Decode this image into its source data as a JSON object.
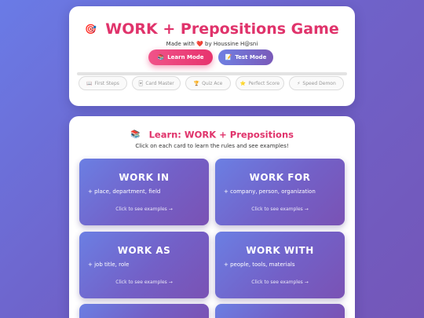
{
  "header": {
    "title_icon": "🎯",
    "title": "WORK + Prepositions Game",
    "credit_prefix": "Made with",
    "credit_heart": "❤️",
    "credit_suffix": "by Houssine H@sni",
    "learn_mode": {
      "icon": "📚",
      "label": "Learn Mode"
    },
    "test_mode": {
      "icon": "📝",
      "label": "Test Mode"
    },
    "progress": 0
  },
  "badges": [
    {
      "icon": "📖",
      "label": "First Steps"
    },
    {
      "icon": "🃏",
      "label": "Card Master"
    },
    {
      "icon": "🏆",
      "label": "Quiz Ace"
    },
    {
      "icon": "⭐",
      "label": "Perfect Score"
    },
    {
      "icon": "⚡",
      "label": "Speed Demon"
    }
  ],
  "learn": {
    "icon": "📚",
    "title": "Learn: WORK + Prepositions",
    "instruction": "Click on each card to learn the rules and see examples!",
    "cards": [
      {
        "title": "WORK IN",
        "rule": "+ place, department, field",
        "hint": "Click to see examples →"
      },
      {
        "title": "WORK FOR",
        "rule": "+ company, person, organization",
        "hint": "Click to see examples →"
      },
      {
        "title": "WORK AS",
        "rule": "+ job title, role",
        "hint": "Click to see examples →"
      },
      {
        "title": "WORK WITH",
        "rule": "+ people, tools, materials",
        "hint": "Click to see examples →"
      },
      {
        "title": "",
        "rule": "",
        "hint": ""
      },
      {
        "title": "",
        "rule": "",
        "hint": ""
      }
    ]
  }
}
